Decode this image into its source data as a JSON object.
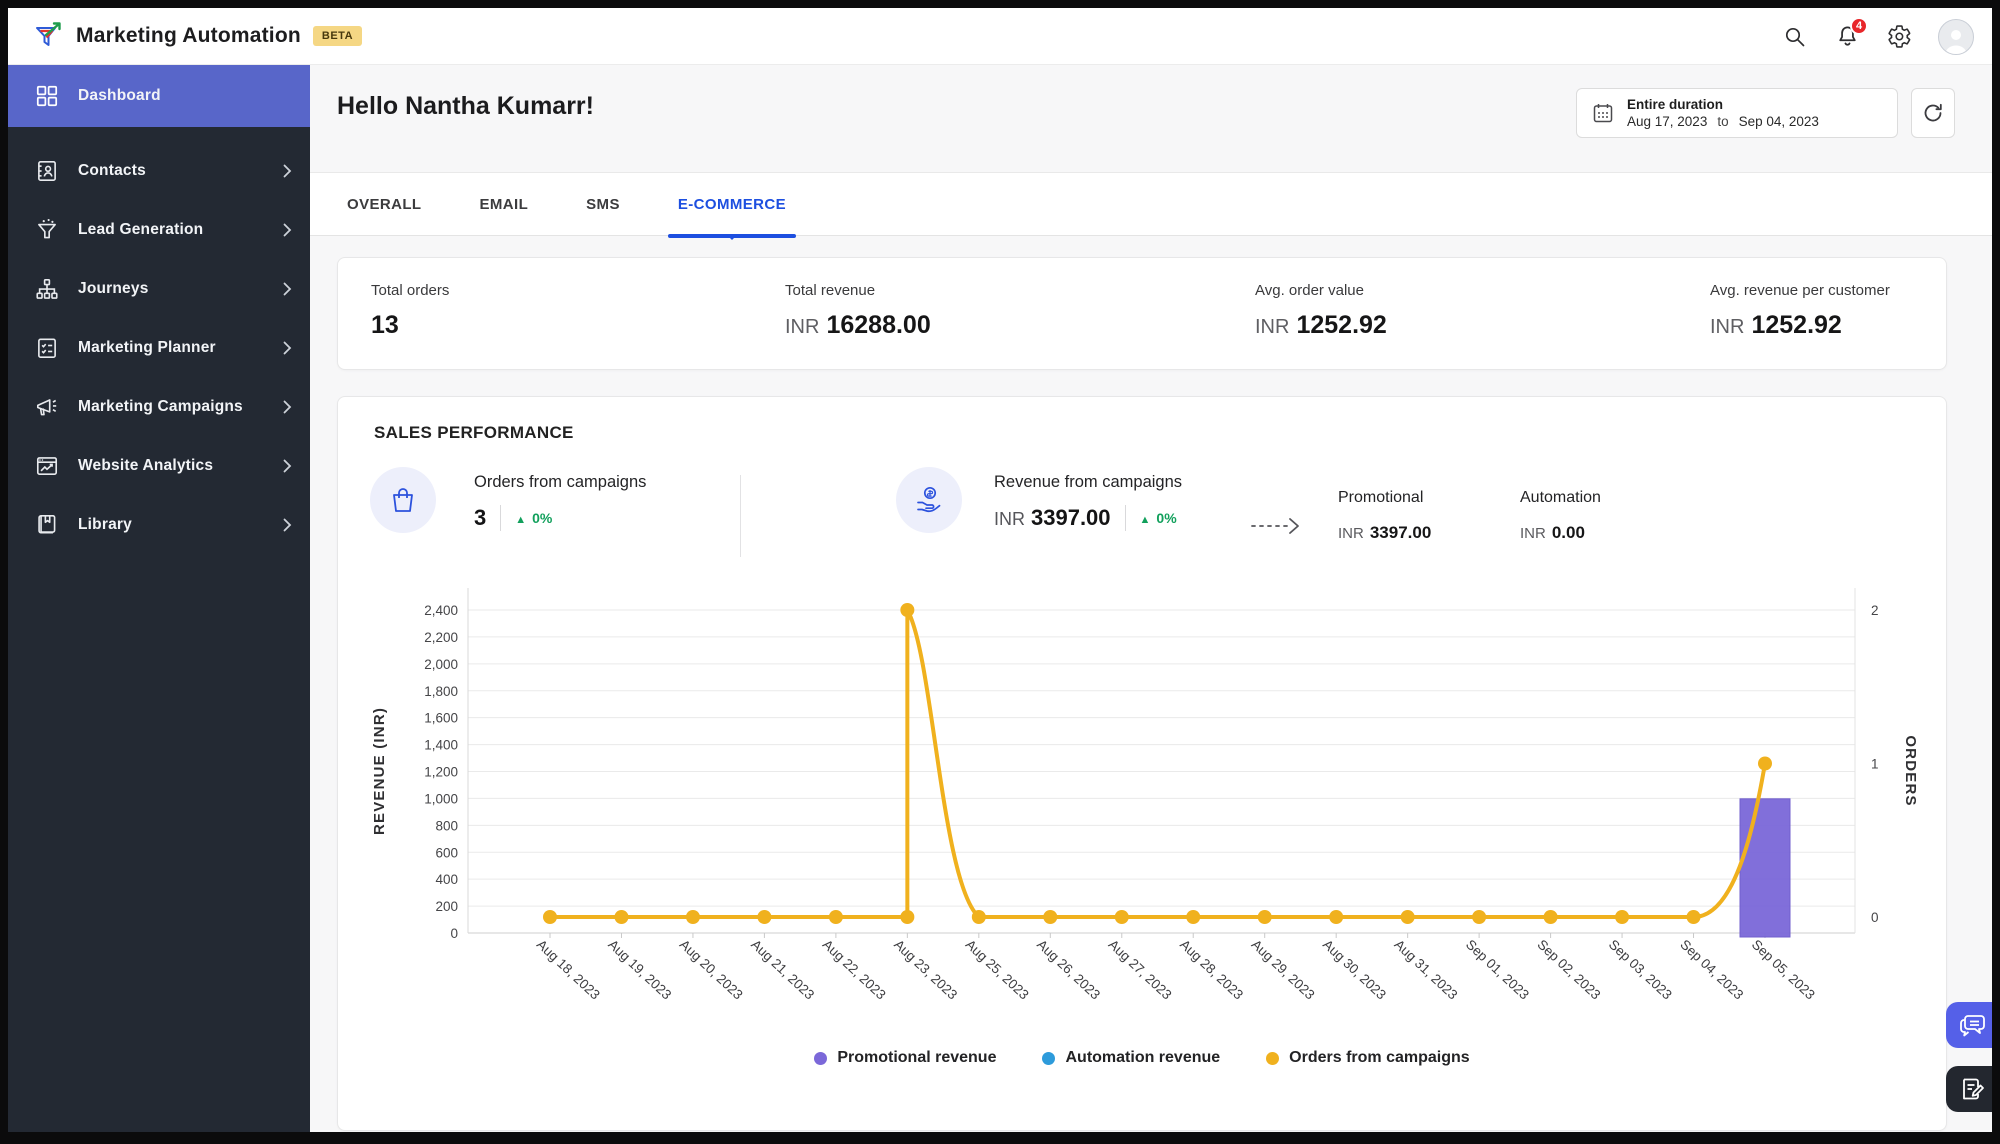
{
  "topbar": {
    "app_title": "Marketing Automation",
    "beta_label": "BETA",
    "notification_count": "4"
  },
  "sidebar": {
    "items": [
      {
        "label": "Dashboard",
        "active": true
      },
      {
        "label": "Contacts",
        "active": false
      },
      {
        "label": "Lead Generation",
        "active": false
      },
      {
        "label": "Journeys",
        "active": false
      },
      {
        "label": "Marketing Planner",
        "active": false
      },
      {
        "label": "Marketing Campaigns",
        "active": false
      },
      {
        "label": "Website Analytics",
        "active": false
      },
      {
        "label": "Library",
        "active": false
      }
    ]
  },
  "header": {
    "greeting": "Hello Nantha Kumarr!",
    "date_range": {
      "label": "Entire duration",
      "start": "Aug 17, 2023",
      "to": "to",
      "end": "Sep 04, 2023"
    }
  },
  "tabs": [
    {
      "label": "OVERALL",
      "active": false
    },
    {
      "label": "EMAIL",
      "active": false
    },
    {
      "label": "SMS",
      "active": false
    },
    {
      "label": "E-COMMERCE",
      "active": true
    }
  ],
  "stats": [
    {
      "label": "Total orders",
      "value": "13"
    },
    {
      "label": "Total revenue",
      "currency": "INR",
      "value": "16288.00"
    },
    {
      "label": "Avg. order value",
      "currency": "INR",
      "value": "1252.92"
    },
    {
      "label": "Avg. revenue per customer",
      "currency": "INR",
      "value": "1252.92"
    }
  ],
  "sales": {
    "title": "SALES PERFORMANCE",
    "kpis": [
      {
        "icon": "shopping-bag-icon",
        "label": "Orders from campaigns",
        "value": "3",
        "delta": "0%"
      },
      {
        "icon": "hand-coin-icon",
        "label": "Revenue from campaigns",
        "currency": "INR",
        "value": "3397.00",
        "delta": "0%"
      }
    ],
    "breakdown": [
      {
        "label": "Promotional",
        "currency": "INR",
        "value": "3397.00"
      },
      {
        "label": "Automation",
        "currency": "INR",
        "value": "0.00"
      }
    ]
  },
  "chart_data": {
    "type": "line",
    "title": "Sales performance by day (dual axis: revenue bars, orders line)",
    "categories": [
      "Aug 18, 2023",
      "Aug 19, 2023",
      "Aug 20, 2023",
      "Aug 21, 2023",
      "Aug 22, 2023",
      "Aug 23, 2023",
      "Aug 25, 2023",
      "Aug 26, 2023",
      "Aug 27, 2023",
      "Aug 28, 2023",
      "Aug 29, 2023",
      "Aug 30, 2023",
      "Aug 31, 2023",
      "Sep 01, 2023",
      "Sep 02, 2023",
      "Sep 03, 2023",
      "Sep 04, 2023",
      "Sep 05, 2023"
    ],
    "series": [
      {
        "name": "Promotional revenue",
        "kind": "bar",
        "axis": "left",
        "color": "#7b68d9",
        "stroke": "#6a57cc",
        "values": [
          0,
          0,
          0,
          0,
          0,
          0,
          0,
          0,
          0,
          0,
          0,
          0,
          0,
          0,
          0,
          0,
          0,
          997
        ]
      },
      {
        "name": "Automation revenue",
        "kind": "bar",
        "axis": "left",
        "color": "#2d9bdb",
        "stroke": "#2d9bdb",
        "values": [
          0,
          0,
          0,
          0,
          0,
          0,
          0,
          0,
          0,
          0,
          0,
          0,
          0,
          0,
          0,
          0,
          0,
          0
        ]
      },
      {
        "name": "Orders from campaigns",
        "kind": "line",
        "axis": "right",
        "color": "#f0b11e",
        "values": [
          0,
          0,
          0,
          0,
          0,
          2,
          0,
          0,
          0,
          0,
          0,
          0,
          0,
          0,
          0,
          0,
          0,
          1
        ]
      }
    ],
    "ylabel_left": "REVENUE (INR)",
    "ylabel_right": "ORDERS",
    "yticks_left": [
      0,
      200,
      400,
      600,
      800,
      1000,
      1200,
      1400,
      1600,
      1800,
      2000,
      2200,
      2400
    ],
    "yticks_right": [
      0,
      1,
      2
    ],
    "ylim_left": [
      0,
      2400
    ],
    "ylim_right": [
      0,
      2
    ],
    "grid": true,
    "legend_position": "bottom"
  },
  "colors": {
    "accent_blue": "#1d4fe0",
    "sidebar_active": "#5866c9",
    "line_yellow": "#f0b11e",
    "bar_purple": "#7b68d9",
    "automation_blue": "#2d9bdb",
    "positive_green": "#12a05c",
    "badge_red": "#e8262a"
  }
}
